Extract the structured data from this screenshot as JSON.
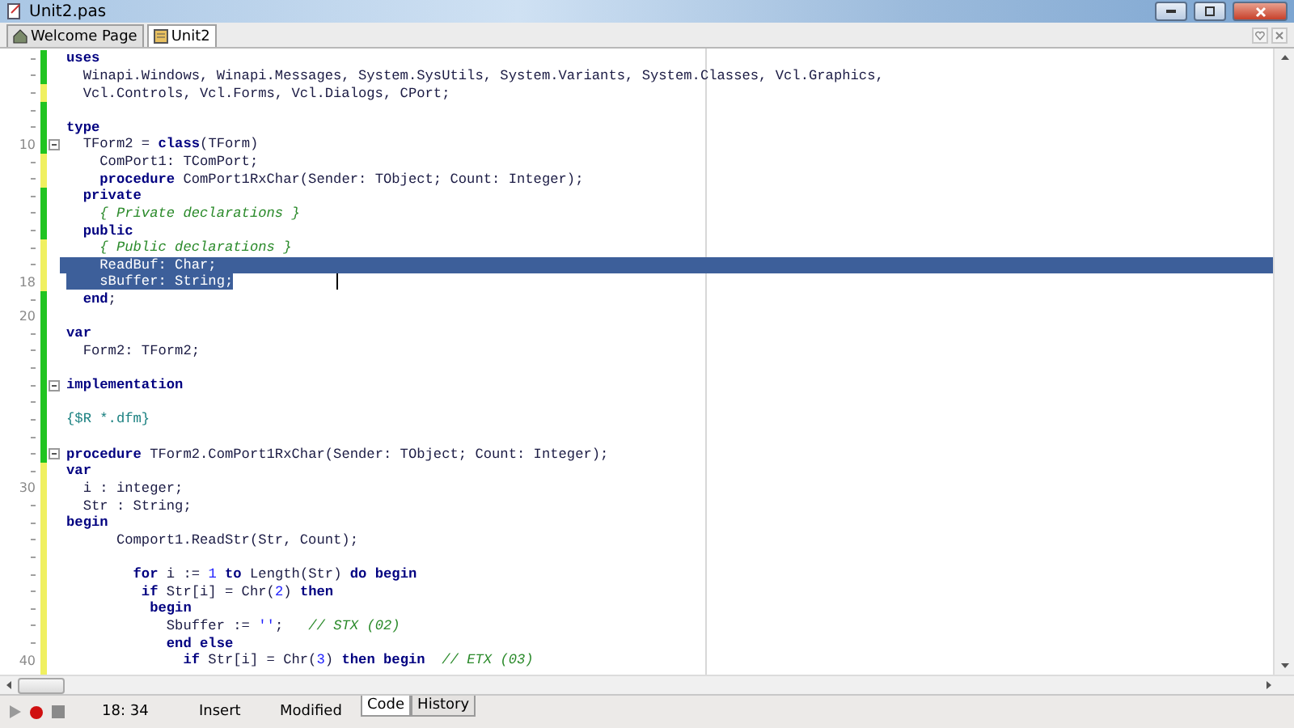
{
  "window": {
    "title": "Unit2.pas"
  },
  "tabs": [
    {
      "label": "Welcome Page",
      "selected": false
    },
    {
      "label": "Unit2",
      "selected": true
    }
  ],
  "editor": {
    "lines": [
      {
        "modified": false,
        "segments": [
          {
            "kind": "keyword",
            "text": "uses"
          }
        ]
      },
      {
        "modified": false,
        "segments": [
          {
            "kind": "plain",
            "text": "  Winapi.Windows, Winapi.Messages, System.SysUtils, System.Variants, System.Classes, Vcl.Graphics,"
          }
        ]
      },
      {
        "modified": true,
        "segments": [
          {
            "kind": "plain",
            "text": "  Vcl.Controls, Vcl.Forms, Vcl.Dialogs, CPort;"
          }
        ]
      },
      {
        "modified": false
      },
      {
        "modified": false,
        "segments": [
          {
            "kind": "keyword",
            "text": "type"
          }
        ]
      },
      {
        "modified": false,
        "number": "10",
        "expanded": true,
        "segments": [
          {
            "kind": "plain",
            "text": "  TForm2 = "
          },
          {
            "kind": "keyword",
            "text": "class"
          },
          {
            "kind": "plain",
            "text": "(TForm)"
          }
        ]
      },
      {
        "modified": true,
        "segments": [
          {
            "kind": "plain",
            "text": "    ComPort1: TComPort;"
          }
        ]
      },
      {
        "modified": true,
        "segments": [
          {
            "kind": "keyword",
            "text": "    procedure"
          },
          {
            "kind": "plain",
            "text": " ComPort1RxChar(Sender: TObject; Count: Integer);"
          }
        ]
      },
      {
        "modified": false,
        "segments": [
          {
            "kind": "keyword",
            "text": "  private"
          }
        ]
      },
      {
        "modified": false,
        "segments": [
          {
            "kind": "comment",
            "text": "    { Private declarations }"
          }
        ]
      },
      {
        "modified": false,
        "segments": [
          {
            "kind": "keyword",
            "text": "  public"
          }
        ]
      },
      {
        "modified": true,
        "segments": [
          {
            "kind": "comment",
            "text": "    { Public declarations }"
          }
        ]
      },
      {
        "modified": true,
        "selected": true,
        "segments": [
          {
            "kind": "plain",
            "text": "    ReadBuf: Char;"
          }
        ]
      },
      {
        "modified": true,
        "number": "18",
        "selected": true,
        "caret": true,
        "segments": [
          {
            "kind": "plain",
            "text": "    sBuffer: String;"
          }
        ]
      },
      {
        "modified": false,
        "segments": [
          {
            "kind": "keyword",
            "text": "  end"
          },
          {
            "kind": "plain",
            "text": ";"
          }
        ]
      },
      {
        "modified": false,
        "number": "20"
      },
      {
        "modified": false,
        "segments": [
          {
            "kind": "keyword",
            "text": "var"
          }
        ]
      },
      {
        "modified": false,
        "segments": [
          {
            "kind": "plain",
            "text": "  Form2: TForm2;"
          }
        ]
      },
      {
        "modified": false
      },
      {
        "modified": false,
        "expanded": true,
        "segments": [
          {
            "kind": "keyword",
            "text": "implementation"
          }
        ]
      },
      {
        "modified": false
      },
      {
        "modified": false,
        "segments": [
          {
            "kind": "directive",
            "text": "{$R *.dfm}"
          }
        ]
      },
      {
        "modified": false
      },
      {
        "modified": false,
        "expanded": true,
        "segments": [
          {
            "kind": "keyword",
            "text": "procedure"
          },
          {
            "kind": "plain",
            "text": " TForm2.ComPort1RxChar(Sender: TObject; Count: Integer);"
          }
        ]
      },
      {
        "modified": true,
        "segments": [
          {
            "kind": "keyword",
            "text": "var"
          }
        ]
      },
      {
        "modified": true,
        "number": "30",
        "segments": [
          {
            "kind": "plain",
            "text": "  i : integer;"
          }
        ]
      },
      {
        "modified": true,
        "segments": [
          {
            "kind": "plain",
            "text": "  Str : String;"
          }
        ]
      },
      {
        "modified": true,
        "segments": [
          {
            "kind": "keyword",
            "text": "begin"
          }
        ]
      },
      {
        "modified": true,
        "segments": [
          {
            "kind": "plain",
            "text": "      Comport1.ReadStr(Str, Count);"
          }
        ]
      },
      {
        "modified": true
      },
      {
        "modified": true,
        "segments": [
          {
            "kind": "keyword",
            "text": "        for"
          },
          {
            "kind": "plain",
            "text": " i := "
          },
          {
            "kind": "number",
            "text": "1"
          },
          {
            "kind": "keyword",
            "text": " to"
          },
          {
            "kind": "plain",
            "text": " Length(Str) "
          },
          {
            "kind": "keyword",
            "text": "do begin"
          }
        ]
      },
      {
        "modified": true,
        "segments": [
          {
            "kind": "keyword",
            "text": "         if"
          },
          {
            "kind": "plain",
            "text": " Str[i] = Chr("
          },
          {
            "kind": "number",
            "text": "2"
          },
          {
            "kind": "plain",
            "text": ") "
          },
          {
            "kind": "keyword",
            "text": "then"
          }
        ]
      },
      {
        "modified": true,
        "segments": [
          {
            "kind": "keyword",
            "text": "          begin"
          }
        ]
      },
      {
        "modified": true,
        "segments": [
          {
            "kind": "plain",
            "text": "            Sbuffer := "
          },
          {
            "kind": "string",
            "text": "''"
          },
          {
            "kind": "plain",
            "text": ";   "
          },
          {
            "kind": "comment",
            "text": "// STX (02)"
          }
        ]
      },
      {
        "modified": true,
        "segments": [
          {
            "kind": "keyword",
            "text": "            end else"
          }
        ]
      },
      {
        "modified": true,
        "number": "40",
        "segments": [
          {
            "kind": "keyword",
            "text": "              if"
          },
          {
            "kind": "plain",
            "text": " Str[i] = Chr("
          },
          {
            "kind": "number",
            "text": "3"
          },
          {
            "kind": "plain",
            "text": ") "
          },
          {
            "kind": "keyword",
            "text": "then begin"
          },
          {
            "kind": "comment",
            "text": "  // ETX (03)"
          }
        ]
      },
      {
        "modified": true
      }
    ]
  },
  "status_bar": {
    "position": "18: 34",
    "mode": "Insert",
    "state": "Modified",
    "views": [
      {
        "label": "Code",
        "selected": true
      },
      {
        "label": "History",
        "selected": false
      }
    ]
  }
}
